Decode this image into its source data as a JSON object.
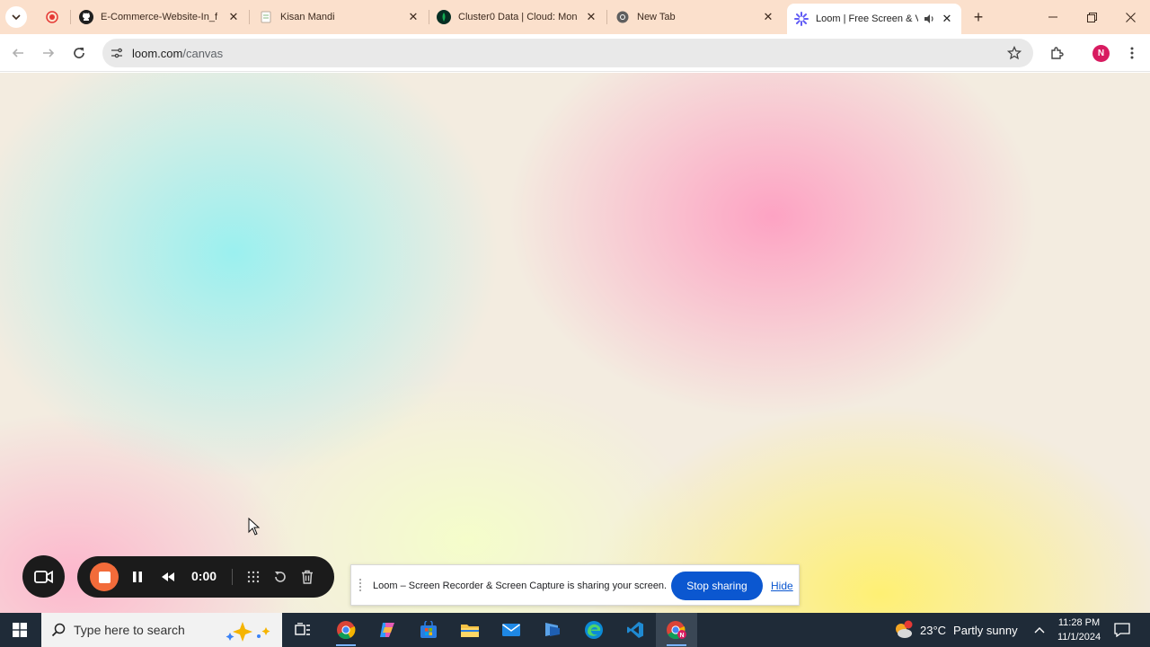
{
  "browser": {
    "tabs": [
      {
        "label": "",
        "icon": "recording-dot-icon",
        "active": false
      },
      {
        "label": "E-Commerce-Website-In_f",
        "icon": "github-icon",
        "active": false
      },
      {
        "label": "Kisan Mandi",
        "icon": "page-icon",
        "active": false
      },
      {
        "label": "Cluster0 Data | Cloud: Mon",
        "icon": "mongodb-leaf-icon",
        "active": false
      },
      {
        "label": "New Tab",
        "icon": "chrome-icon",
        "active": false
      },
      {
        "label": "Loom | Free Screen & V",
        "icon": "loom-icon",
        "active": true
      }
    ],
    "address": {
      "host": "loom.com",
      "path": "/canvas"
    },
    "profile_initial": "N"
  },
  "loom": {
    "timer": "0:00"
  },
  "share_notice": {
    "message": "Loom – Screen Recorder & Screen Capture is sharing your screen.",
    "stop_label": "Stop sharing",
    "hide_label": "Hide"
  },
  "taskbar": {
    "search_placeholder": "Type here to search",
    "weather": {
      "temp": "23°C",
      "condition": "Partly sunny",
      "badge": "1"
    },
    "time": "11:28 PM",
    "date": "11/1/2024"
  },
  "colors": {
    "tabstrip": "#fbe0cc",
    "loom_accent": "#f26b3a",
    "share_blue": "#0b57d0",
    "taskbar": "#1f2b38"
  }
}
